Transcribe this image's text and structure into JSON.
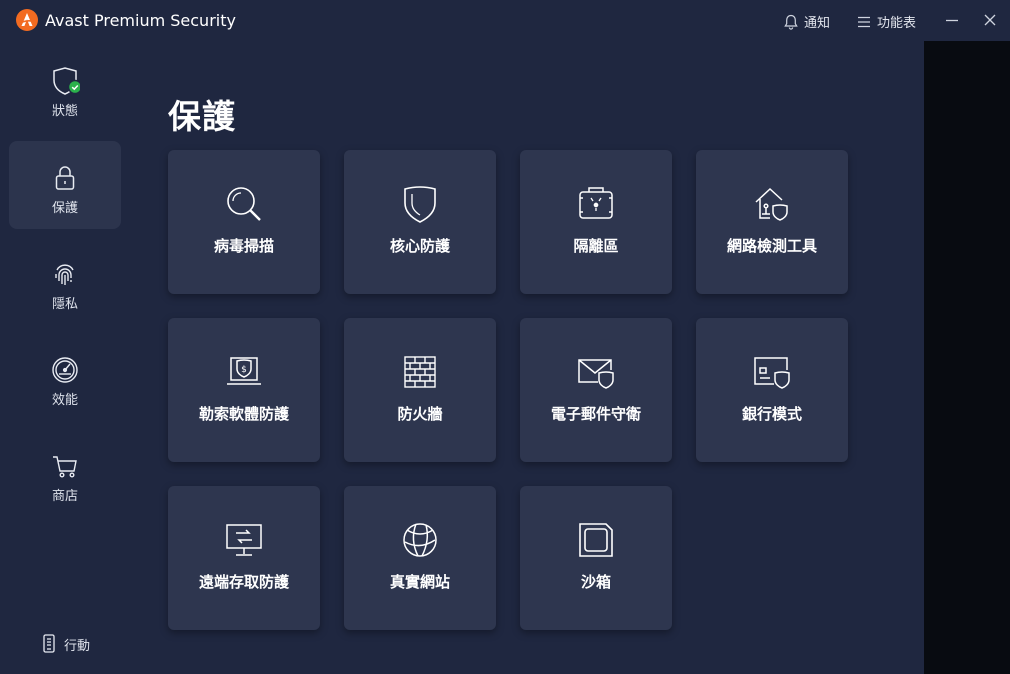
{
  "app": {
    "title": "Avast Premium Security"
  },
  "titlebar": {
    "notify_label": "通知",
    "menu_label": "功能表"
  },
  "sidebar": {
    "items": [
      {
        "label": "狀態",
        "icon": "shield-check-icon",
        "active": false
      },
      {
        "label": "保護",
        "icon": "lock-icon",
        "active": true
      },
      {
        "label": "隱私",
        "icon": "fingerprint-icon",
        "active": false
      },
      {
        "label": "效能",
        "icon": "speedometer-icon",
        "active": false
      },
      {
        "label": "商店",
        "icon": "cart-icon",
        "active": false
      }
    ],
    "mobile_label": "行動"
  },
  "main": {
    "title": "保護",
    "tiles": [
      {
        "label": "病毒掃描",
        "icon": "magnifier-icon"
      },
      {
        "label": "核心防護",
        "icon": "shield-icon"
      },
      {
        "label": "隔離區",
        "icon": "quarantine-icon"
      },
      {
        "label": "網路檢測工具",
        "icon": "home-network-shield-icon"
      },
      {
        "label": "勒索軟體防護",
        "icon": "ransomware-laptop-icon"
      },
      {
        "label": "防火牆",
        "icon": "brick-wall-icon"
      },
      {
        "label": "電子郵件守衛",
        "icon": "mail-shield-icon"
      },
      {
        "label": "銀行模式",
        "icon": "card-shield-icon"
      },
      {
        "label": "遠端存取防護",
        "icon": "remote-monitor-icon"
      },
      {
        "label": "真實網站",
        "icon": "globe-icon"
      },
      {
        "label": "沙箱",
        "icon": "sandbox-icon"
      }
    ]
  },
  "colors": {
    "background": "#1f2740",
    "tile": "#2e364f",
    "nav_active": "#2c344d",
    "brand_orange": "#f26b21",
    "status_green": "#2bb24c"
  }
}
